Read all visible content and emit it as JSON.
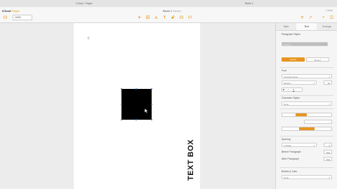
{
  "browser_tabs": [
    "iCloud - Pages",
    "Blank 2"
  ],
  "app": {
    "brand": "iCloud",
    "product": "Pages"
  },
  "document": {
    "title": "Blank 2",
    "status": "Saved"
  },
  "toolbar": {
    "zoom": "100%",
    "right_text": "Collab"
  },
  "canvas": {
    "text_box": "TEXT BOX"
  },
  "sidebar": {
    "tabs": [
      "Style",
      "Text",
      "Arrange"
    ],
    "active_tab": "Text",
    "paragraph_styles_label": "Paragraph Styles",
    "paragraph_style_value": "Custom",
    "update_button": "Update",
    "revert_button": "Revert",
    "font_label": "Font",
    "font_family": "Helvetica Neue",
    "font_weight": "Medium",
    "font_size": "11",
    "character_styles_label": "Character Styles",
    "character_style_value": "None",
    "spacing_label": "Spacing",
    "line_spacing": "1 Single",
    "line_spacing_value": "1",
    "before_paragraph_label": "Before Paragraph",
    "before_paragraph_value": "0 pt",
    "after_paragraph_label": "After Paragraph",
    "after_paragraph_value": "0 pt",
    "bullets_label": "Bullets & Lists",
    "bullets_value": "None"
  },
  "colors": {
    "accent": "#e8951f",
    "selection": "#2f7cd8"
  }
}
